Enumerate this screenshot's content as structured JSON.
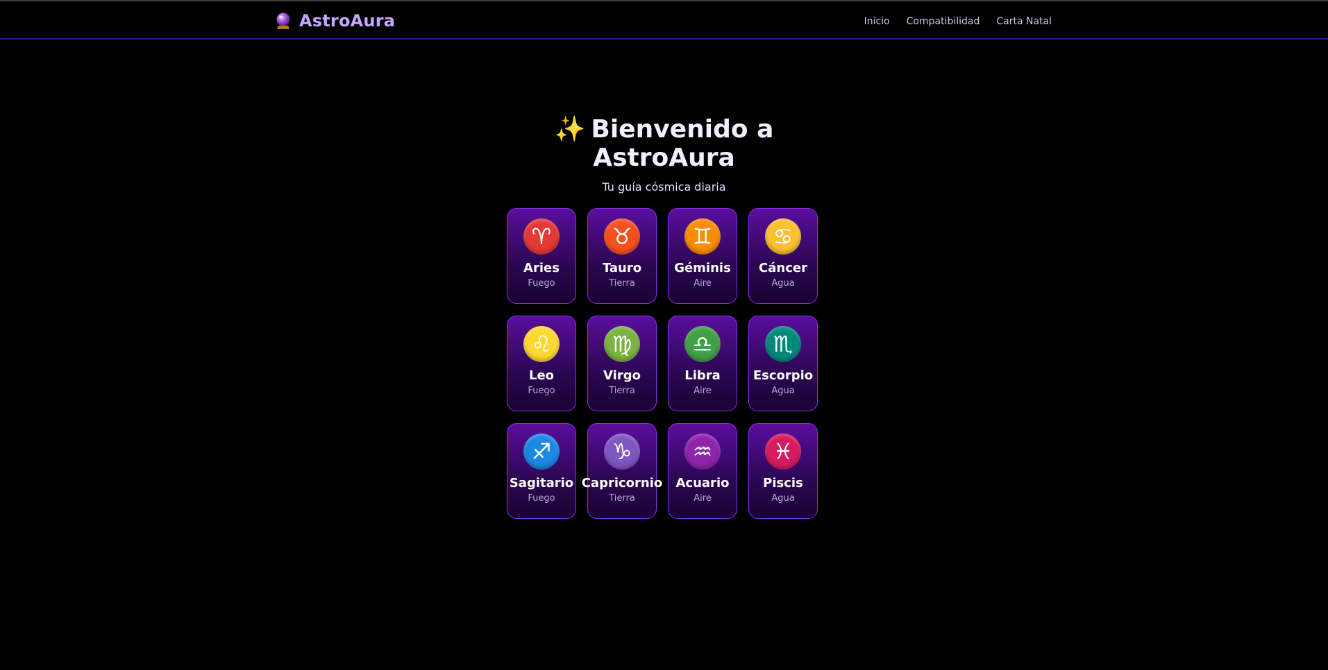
{
  "header": {
    "brand": "AstroAura",
    "nav": [
      "Inicio",
      "Compatibilidad",
      "Carta Natal"
    ]
  },
  "hero": {
    "sparkle": "✨",
    "title": "Bienvenido a AstroAura",
    "subtitle": "Tu guía cósmica diaria"
  },
  "signs": [
    {
      "name": "Aries",
      "element": "Fuego",
      "glyph": "♈",
      "icon": "aries-icon",
      "color": "#e53935"
    },
    {
      "name": "Tauro",
      "element": "Tierra",
      "glyph": "♉",
      "icon": "taurus-icon",
      "color": "#f4511e"
    },
    {
      "name": "Géminis",
      "element": "Aire",
      "glyph": "♊",
      "icon": "gemini-icon",
      "color": "#fb8c00"
    },
    {
      "name": "Cáncer",
      "element": "Agua",
      "glyph": "♋",
      "icon": "cancer-icon",
      "color": "#fbc02d"
    },
    {
      "name": "Leo",
      "element": "Fuego",
      "glyph": "♌",
      "icon": "leo-icon",
      "color": "#fdd835"
    },
    {
      "name": "Virgo",
      "element": "Tierra",
      "glyph": "♍",
      "icon": "virgo-icon",
      "color": "#7cb342"
    },
    {
      "name": "Libra",
      "element": "Aire",
      "glyph": "♎",
      "icon": "libra-icon",
      "color": "#43a047"
    },
    {
      "name": "Escorpio",
      "element": "Agua",
      "glyph": "♏",
      "icon": "scorpio-icon",
      "color": "#00897b"
    },
    {
      "name": "Sagitario",
      "element": "Fuego",
      "glyph": "♐",
      "icon": "sagittarius-icon",
      "color": "#1e88e5"
    },
    {
      "name": "Capricornio",
      "element": "Tierra",
      "glyph": "♑",
      "icon": "capricorn-icon",
      "color": "#7e57c2"
    },
    {
      "name": "Acuario",
      "element": "Aire",
      "glyph": "♒",
      "icon": "aquarius-icon",
      "color": "#8e24aa"
    },
    {
      "name": "Piscis",
      "element": "Agua",
      "glyph": "♓",
      "icon": "pisces-icon",
      "color": "#d81b60"
    }
  ]
}
